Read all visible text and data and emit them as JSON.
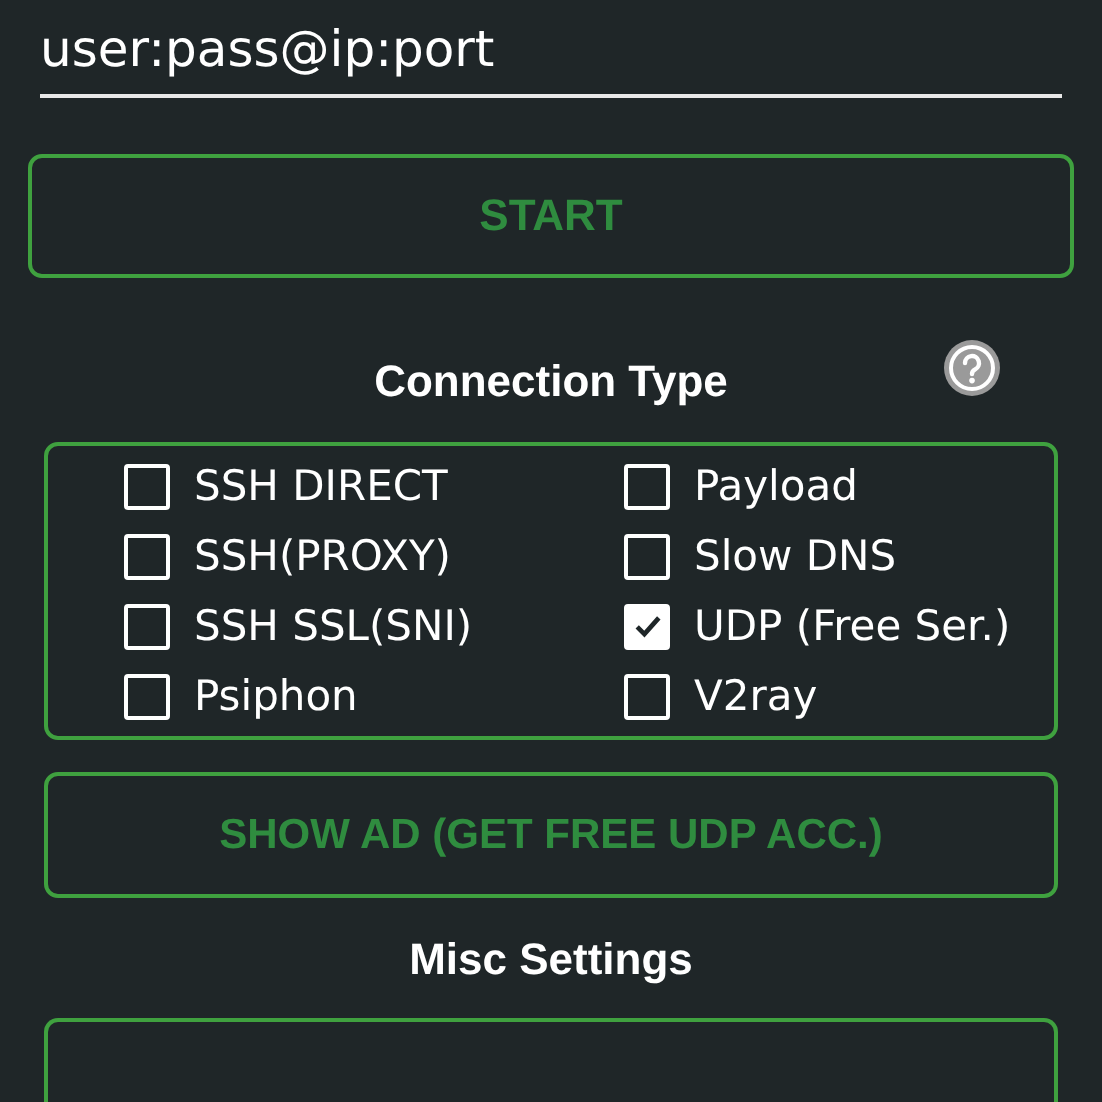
{
  "server_field": {
    "placeholder": "user:pass@ip:port"
  },
  "start_button": {
    "label": "START"
  },
  "connection_type": {
    "title": "Connection Type",
    "options": [
      {
        "label": "SSH DIRECT",
        "checked": false
      },
      {
        "label": "Payload",
        "checked": false
      },
      {
        "label": "SSH(PROXY)",
        "checked": false
      },
      {
        "label": "Slow DNS",
        "checked": false
      },
      {
        "label": "SSH SSL(SNI)",
        "checked": false
      },
      {
        "label": "UDP (Free Ser.)",
        "checked": true
      },
      {
        "label": "Psiphon",
        "checked": false
      },
      {
        "label": "V2ray",
        "checked": false
      }
    ]
  },
  "ad_button": {
    "label": "SHOW AD (GET FREE UDP ACC.)"
  },
  "misc_settings": {
    "title": "Misc Settings"
  }
}
